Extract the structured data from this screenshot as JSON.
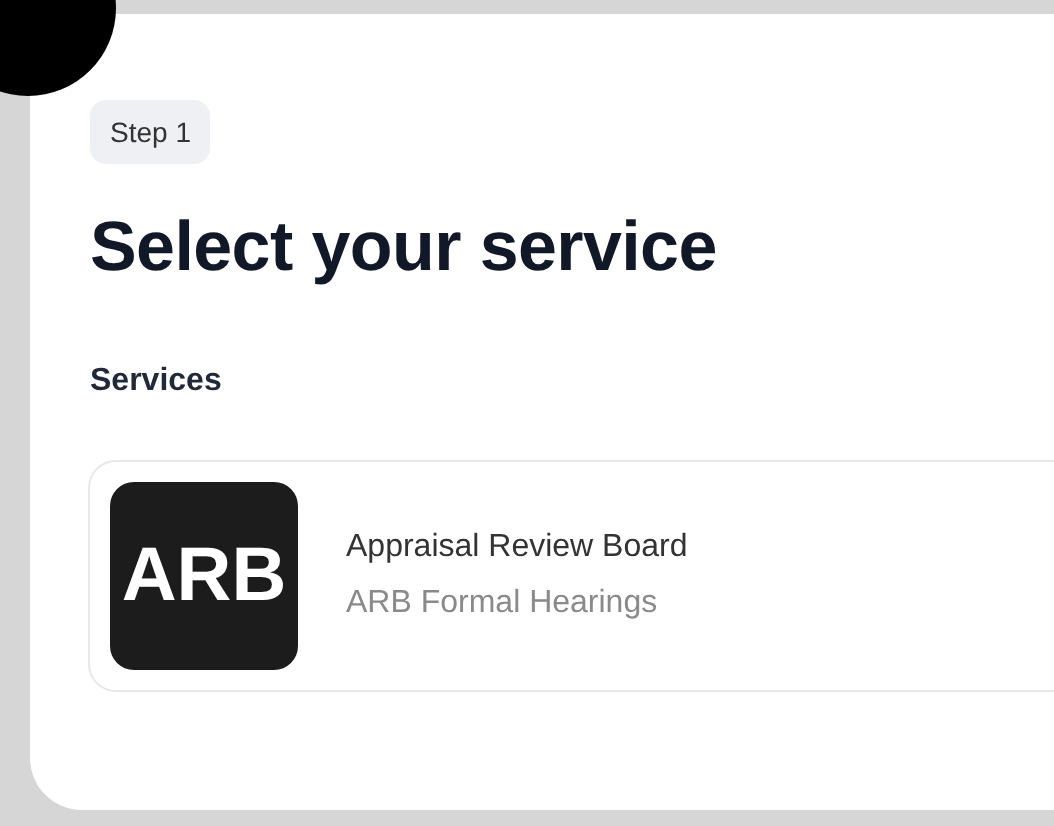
{
  "step_badge": "Step 1",
  "heading": "Select your service",
  "section_label": "Services",
  "services": [
    {
      "logo": "ARB",
      "title": "Appraisal Review Board",
      "subtitle": "ARB Formal Hearings"
    }
  ]
}
